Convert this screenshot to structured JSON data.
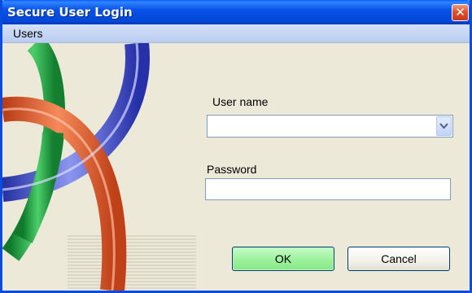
{
  "window": {
    "title": "Secure User Login",
    "close_glyph": "✕"
  },
  "menu": {
    "users_label": "Users"
  },
  "form": {
    "username_label": "User name",
    "username_value": "",
    "password_label": "Password",
    "password_value": ""
  },
  "buttons": {
    "ok_label": "OK",
    "cancel_label": "Cancel"
  },
  "icons": {
    "close": "close-icon",
    "dropdown": "chevron-down-icon",
    "logo": "interlocking-rings-logo"
  },
  "colors": {
    "title_bar": "#0a52e8",
    "ok_button": "#9ff29f",
    "ring_green": "#2aa64a",
    "ring_blue": "#3a48c8",
    "ring_orange": "#e06030"
  }
}
